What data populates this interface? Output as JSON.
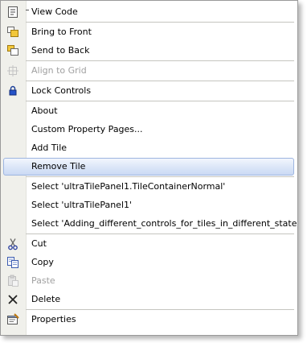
{
  "menu": {
    "items": [
      {
        "label": "View Code",
        "icon": "view-code-icon"
      },
      {
        "label": "Bring to Front",
        "icon": "bring-to-front-icon"
      },
      {
        "label": "Send to Back",
        "icon": "send-to-back-icon"
      },
      {
        "label": "Align to Grid",
        "icon": "align-to-grid-icon",
        "disabled": true
      },
      {
        "label": "Lock Controls",
        "icon": "lock-icon"
      },
      {
        "label": "About"
      },
      {
        "label": "Custom Property Pages..."
      },
      {
        "label": "Add Tile"
      },
      {
        "label": "Remove Tile",
        "highlighted": true
      },
      {
        "label": "Select 'ultraTilePanel1.TileContainerNormal'"
      },
      {
        "label": "Select 'ultraTilePanel1'"
      },
      {
        "label": "Select 'Adding_different_controls_for_tiles_in_different_states'"
      },
      {
        "label": "Cut",
        "icon": "cut-icon"
      },
      {
        "label": "Copy",
        "icon": "copy-icon"
      },
      {
        "label": "Paste",
        "icon": "paste-icon",
        "disabled": true
      },
      {
        "label": "Delete",
        "icon": "delete-icon"
      },
      {
        "label": "Properties",
        "icon": "properties-icon"
      }
    ]
  },
  "colors": {
    "highlight_border": "#9db5e0",
    "disabled_text": "#a0a0a0",
    "gutter": "#f0f0eb"
  }
}
